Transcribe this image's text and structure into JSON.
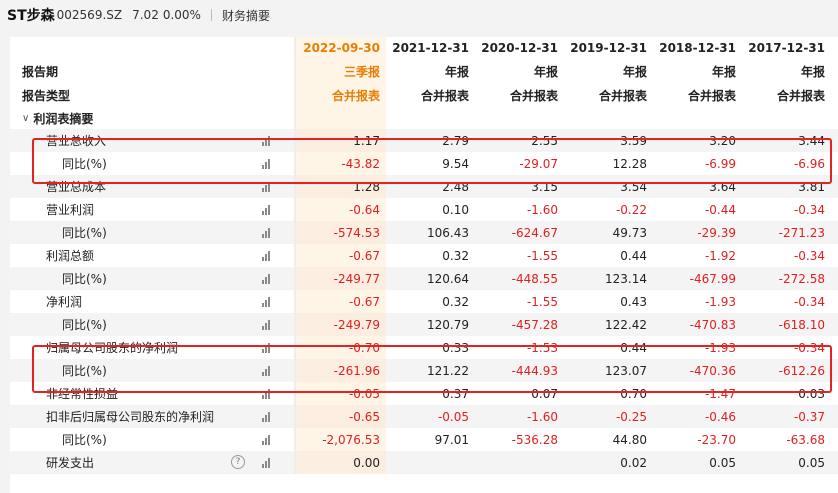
{
  "header": {
    "stock_name": "ST步森",
    "stock_code": "002569.SZ",
    "price": "7.02",
    "change": "0.00%",
    "section": "财务摘要"
  },
  "table": {
    "period_label": "报告期",
    "type_label": "报告类型",
    "dates": [
      "2022-09-30",
      "2021-12-31",
      "2020-12-31",
      "2019-12-31",
      "2018-12-31",
      "2017-12-31"
    ],
    "periods": [
      "三季报",
      "年报",
      "年报",
      "年报",
      "年报",
      "年报"
    ],
    "types": [
      "合并报表",
      "合并报表",
      "合并报表",
      "合并报表",
      "合并报表",
      "合并报表"
    ],
    "group_title": "利润表摘要",
    "rows": [
      {
        "label": "营业总收入",
        "values": [
          "1.17",
          "2.79",
          "2.55",
          "3.59",
          "3.20",
          "3.44"
        ]
      },
      {
        "label": "同比(%)",
        "values": [
          "-43.82",
          "9.54",
          "-29.07",
          "12.28",
          "-6.99",
          "-6.96"
        ]
      },
      {
        "label": "营业总成本",
        "values": [
          "1.28",
          "2.48",
          "3.15",
          "3.54",
          "3.64",
          "3.81"
        ]
      },
      {
        "label": "营业利润",
        "values": [
          "-0.64",
          "0.10",
          "-1.60",
          "-0.22",
          "-0.44",
          "-0.34"
        ]
      },
      {
        "label": "同比(%)",
        "values": [
          "-574.53",
          "106.43",
          "-624.67",
          "49.73",
          "-29.39",
          "-271.23"
        ]
      },
      {
        "label": "利润总额",
        "values": [
          "-0.67",
          "0.32",
          "-1.55",
          "0.44",
          "-1.92",
          "-0.34"
        ]
      },
      {
        "label": "同比(%)",
        "values": [
          "-249.77",
          "120.64",
          "-448.55",
          "123.14",
          "-467.99",
          "-272.58"
        ]
      },
      {
        "label": "净利润",
        "values": [
          "-0.67",
          "0.32",
          "-1.55",
          "0.43",
          "-1.93",
          "-0.34"
        ]
      },
      {
        "label": "同比(%)",
        "values": [
          "-249.79",
          "120.79",
          "-457.28",
          "122.42",
          "-470.83",
          "-618.10"
        ]
      },
      {
        "label": "归属母公司股东的净利润",
        "values": [
          "-0.70",
          "0.33",
          "-1.53",
          "0.44",
          "-1.93",
          "-0.34"
        ]
      },
      {
        "label": "同比(%)",
        "values": [
          "-261.96",
          "121.22",
          "-444.93",
          "123.07",
          "-470.36",
          "-612.26"
        ]
      },
      {
        "label": "非经常性损益",
        "values": [
          "-0.05",
          "0.37",
          "0.07",
          "0.70",
          "-1.47",
          "0.03"
        ]
      },
      {
        "label": "扣非后归属母公司股东的净利润",
        "values": [
          "-0.65",
          "-0.05",
          "-1.60",
          "-0.25",
          "-0.46",
          "-0.37"
        ]
      },
      {
        "label": "同比(%)",
        "values": [
          "-2,076.53",
          "97.01",
          "-536.28",
          "44.80",
          "-23.70",
          "-63.68"
        ]
      },
      {
        "label": "研发支出",
        "values": [
          "0.00",
          "",
          "",
          "0.02",
          "0.05",
          "0.05"
        ]
      }
    ]
  },
  "help_icon_glyph": "?",
  "colors": {
    "negative": "#e02020",
    "accent": "#e87e04",
    "highlight": "#e32222"
  }
}
